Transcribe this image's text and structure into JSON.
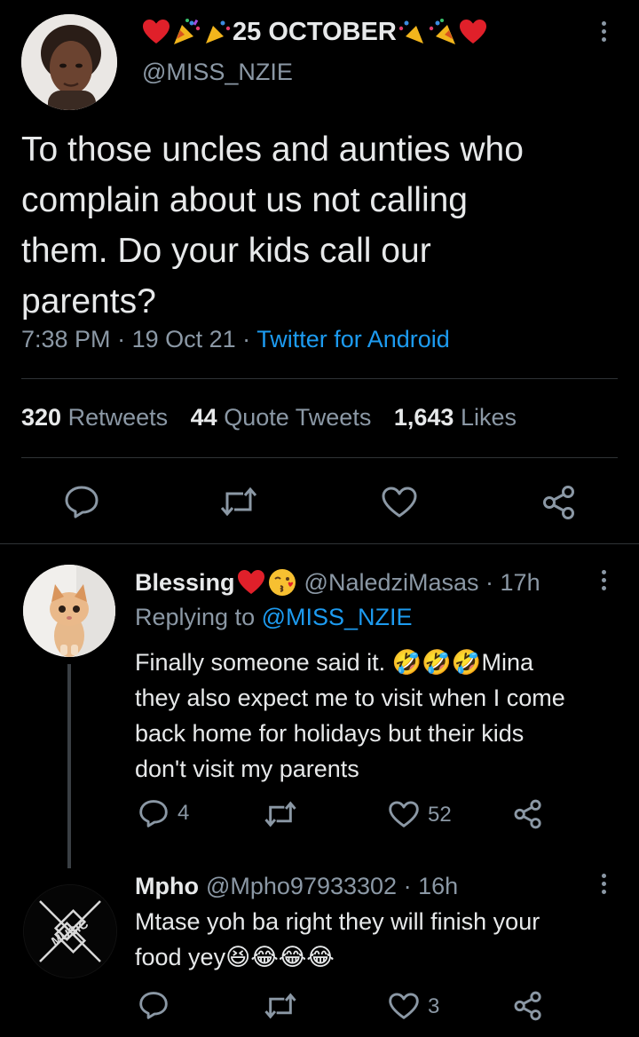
{
  "main_tweet": {
    "display_name": "25 OCTOBER",
    "handle": "@MISS_NZIE",
    "text": "To those uncles and aunties who complain about us not calling them. Do your kids call our parents?",
    "text_lines": [
      "To those uncles and aunties who",
      "complain about us not calling",
      "them. Do your kids call our",
      "parents?"
    ],
    "time": "7:38 PM",
    "date": "19 Oct 21",
    "source": "Twitter for Android",
    "retweets_count": "320",
    "retweets_label": "Retweets",
    "quotes_count": "44",
    "quotes_label": "Quote Tweets",
    "likes_count": "1,643",
    "likes_label": "Likes"
  },
  "replies": [
    {
      "display_name": "Blessing",
      "handle": "@NaledziMasas",
      "age": "17h",
      "replying_label": "Replying to",
      "replying_to": "@MISS_NZIE",
      "text_lines": [
        "Finally someone said it. 🤣🤣🤣Mina",
        "they also expect me to visit when I come",
        "back home for holidays but their kids",
        "don't visit my parents"
      ],
      "reply_count": "4",
      "retweet_count": "",
      "like_count": "52"
    },
    {
      "display_name": "Mpho",
      "handle": "@Mpho97933302",
      "age": "16h",
      "avatar_text": "MUSIC",
      "text_lines": [
        "Mtase yoh ba right they will finish your",
        "food yey😆😂😂😂"
      ],
      "reply_count": "",
      "retweet_count": "",
      "like_count": "3"
    }
  ],
  "colors": {
    "background": "#000000",
    "text": "#e7e9ea",
    "muted": "#8b98a5",
    "link": "#1d9bf0",
    "divider": "#2f3336",
    "heart_red": "#e0202a"
  },
  "icons": [
    "reply-icon",
    "retweet-icon",
    "like-icon",
    "share-icon",
    "more-icon",
    "heart-emoji-icon",
    "party-popper-icon"
  ]
}
